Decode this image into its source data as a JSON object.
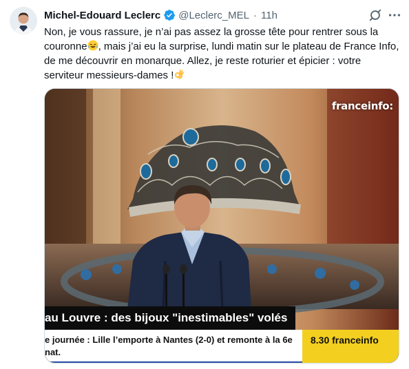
{
  "tweet": {
    "author_name": "Michel-Edouard Leclerc",
    "handle": "@Leclerc_MEL",
    "separator": "·",
    "time": "11h",
    "text_part1": "Non, je vous rassure, je n’ai pas assez la grosse tête pour rentrer sous la couronne",
    "text_part2": ", mais j’ai eu la surprise, lundi matin sur le plateau de France Info, de me découvrir en monarque. Allez, je reste roturier et épicier : votre serviteur messieurs-dames !",
    "emoji1": "laughing-tears-emoji",
    "emoji2": "ok-hand-emoji"
  },
  "media": {
    "channel_logo": "franceinfo:",
    "headline": "au Louvre : des bijoux \"inestimables\" volés",
    "ticker": "e journée : Lille l’emporte à Nantes (2-0) et remonte à la 6e nat.",
    "program": "8.30 franceinfo"
  },
  "colors": {
    "verified_blue": "#1d9bf0",
    "secondary_text": "#536471",
    "ticker_accent": "#2b4ca8",
    "program_yellow": "#f3cf1f"
  },
  "icons": {
    "verified": "verified-badge-icon",
    "grok": "grok-icon",
    "more": "more-dots-icon"
  }
}
